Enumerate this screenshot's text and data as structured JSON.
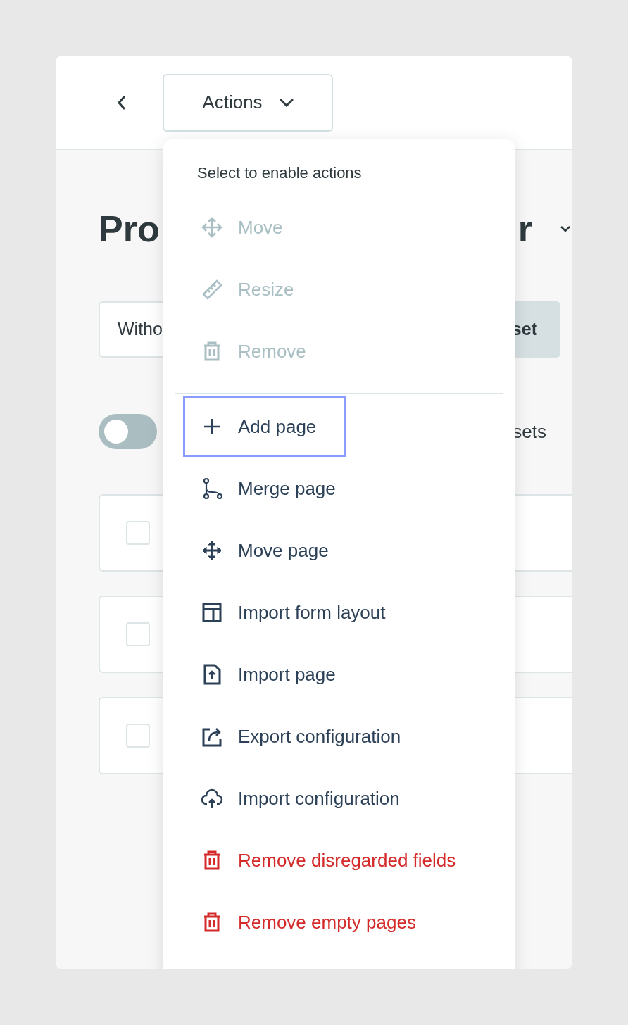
{
  "toolbar": {
    "actions_button": {
      "label": "Actions",
      "expanded": true
    }
  },
  "background": {
    "heading_start": "Pro",
    "heading_end": "r",
    "field_value": "Witho",
    "button_label": "set",
    "toggle": {
      "on": false
    },
    "toggle_label": "sets",
    "rows": [
      {
        "checked": false
      },
      {
        "checked": false
      },
      {
        "checked": false
      }
    ]
  },
  "menu": {
    "header": "Select to enable actions",
    "items": [
      {
        "label": "Move",
        "kind": "normal",
        "disabled": true,
        "focused": false
      },
      {
        "label": "Resize",
        "kind": "normal",
        "disabled": true,
        "focused": false
      },
      {
        "label": "Remove",
        "kind": "normal",
        "disabled": true,
        "focused": false
      },
      {
        "label": "Add page",
        "kind": "normal",
        "disabled": false,
        "focused": true
      },
      {
        "label": "Merge page",
        "kind": "normal",
        "disabled": false,
        "focused": false
      },
      {
        "label": "Move page",
        "kind": "normal",
        "disabled": false,
        "focused": false
      },
      {
        "label": "Import form layout",
        "kind": "normal",
        "disabled": false,
        "focused": false
      },
      {
        "label": "Import page",
        "kind": "normal",
        "disabled": false,
        "focused": false
      },
      {
        "label": "Export configuration",
        "kind": "normal",
        "disabled": false,
        "focused": false
      },
      {
        "label": "Import configuration",
        "kind": "normal",
        "disabled": false,
        "focused": false
      },
      {
        "label": "Remove disregarded fields",
        "kind": "danger",
        "disabled": false,
        "focused": false
      },
      {
        "label": "Remove empty pages",
        "kind": "danger",
        "disabled": false,
        "focused": false
      }
    ]
  }
}
